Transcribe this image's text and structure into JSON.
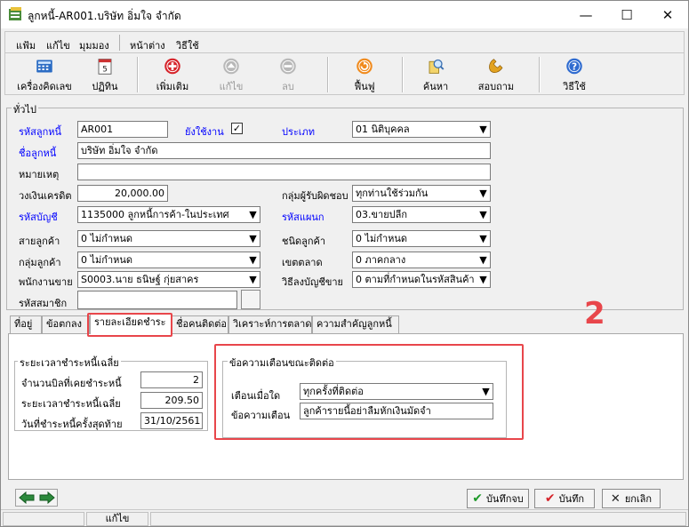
{
  "window": {
    "title": "ลูกหนี้-AR001.บริษัท อิ่มใจ จำกัด",
    "minimize": "—",
    "maximize": "☐",
    "close": "✕"
  },
  "menu": [
    "แฟ้ม",
    "แก้ไข",
    "มุมมอง",
    "หน้าต่าง",
    "วิธีใช้"
  ],
  "toolbar": {
    "calculator": "เครื่องคิดเลข",
    "calendar": "ปฏิทิน",
    "add": "เพิ่มเติม",
    "edit": "แก้ไข",
    "delete": "ลบ",
    "restore": "ฟื้นฟู",
    "search": "ค้นหา",
    "inquiry": "สอบถาม",
    "help": "วิธีใช้"
  },
  "general": {
    "group_title": "ทั่วไป",
    "code_label": "รหัสลูกหนี้",
    "code_value": "AR001",
    "active_label": "ยังใช้งาน",
    "active_check": "✓",
    "type_label": "ประเภท",
    "type_value": "01 นิติบุคคล",
    "name_label": "ชื่อลูกหนี้",
    "name_value": "บริษัท อิ่มใจ จำกัด",
    "remark_label": "หมายเหตุ",
    "remark_value": "",
    "credit_label": "วงเงินเครดิต",
    "credit_value": "20,000.00",
    "responsible_label": "กลุ่มผู้รับผิดชอบ",
    "responsible_value": "ทุกท่านใช้ร่วมกัน",
    "account_label": "รหัสบัญชี",
    "account_value": "1135000 ลูกหนี้การค้า-ในประเทศ",
    "department_label": "รหัสแผนก",
    "department_value": "03.ขายปลีก",
    "line_label": "สายลูกค้า",
    "line_value": "0 ไม่กำหนด",
    "custtype_label": "ชนิดลูกค้า",
    "custtype_value": "0 ไม่กำหนด",
    "group_label": "กลุ่มลูกค้า",
    "group_value": "0 ไม่กำหนด",
    "market_label": "เขตตลาด",
    "market_value": "0 ภาคกลาง",
    "salesman_label": "พนักงานขาย",
    "salesman_value": "S0003.นาย ธนิษฐ์ กุ่ยสาคร",
    "posting_label": "วิธีลงบัญชีขาย",
    "posting_value": "0 ตามที่กำหนดในรหัสสินค้า",
    "member_label": "รหัสสมาชิก",
    "member_value": ""
  },
  "tabs": [
    "ที่อยู่",
    "ข้อตกลง",
    "รายละเอียดชำระ",
    "ชื่อคนติดต่อ",
    "วิเคราะห์การตลาด",
    "ความสำคัญลูกหนี้"
  ],
  "annotation_number": "2",
  "payment": {
    "group_title": "ระยะเวลาชำระหนี้เฉลี่ย",
    "count_label": "จำนวนบิลที่เคยชำระหนี้",
    "count_value": "2",
    "avg_label": "ระยะเวลาชำระหนี้เฉลี่ย",
    "avg_value": "209.50",
    "last_label": "วันที่ชำระหนี้ครั้งสุดท้าย",
    "last_value": "31/10/2561"
  },
  "alert": {
    "group_title": "ข้อความเตือนขณะติดต่อ",
    "when_label": "เตือนเมื่อใด",
    "when_value": "ทุกครั้งที่ติดต่อ",
    "msg_label": "ข้อความเตือน",
    "msg_value": "ลูกค้ารายนี้อย่าลืมหักเงินมัดจำ"
  },
  "buttons": {
    "save_close": "บันทึกจบ",
    "save": "บันทึก",
    "cancel": "ยกเลิก"
  },
  "status": {
    "mode": "แก้ไข"
  },
  "colors": {
    "label_blue": "#0000ff",
    "highlight_red": "#e8464b"
  }
}
